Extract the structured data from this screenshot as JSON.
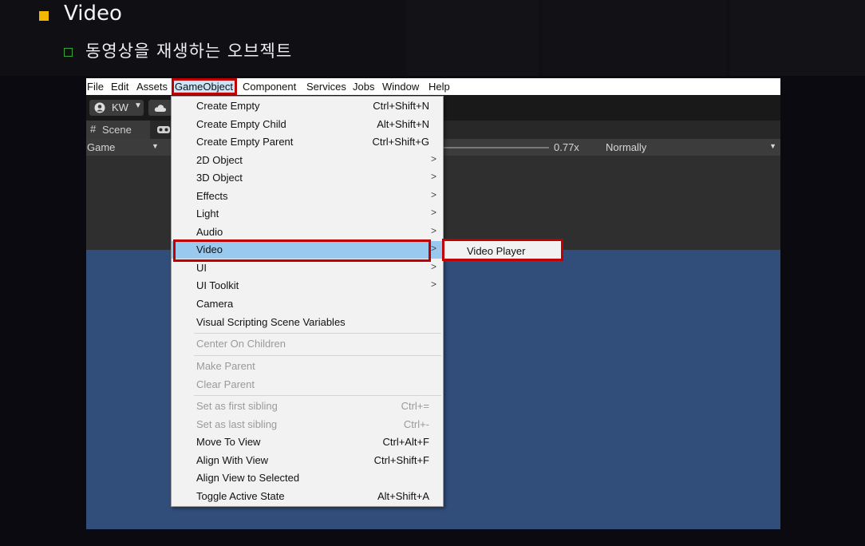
{
  "slide": {
    "title": "Video",
    "subtitle": "동영상을 재생하는 오브젝트",
    "colors": {
      "bullet_main": "#f2b800",
      "bullet_sub": "#3aa63a",
      "highlight_border": "#c00000"
    }
  },
  "unity": {
    "menubar": {
      "items": [
        "File",
        "Edit",
        "Assets",
        "GameObject",
        "Component",
        "Services",
        "Jobs",
        "Window",
        "Help"
      ],
      "active": "GameObject"
    },
    "toolbar": {
      "account_label": "KW",
      "account_icon": "user-icon",
      "cloud_icon": "cloud-icon"
    },
    "scene_tab": {
      "label": "Scene",
      "icon": "hash-icon"
    },
    "game_bar": {
      "display_label": "Game",
      "scale_value": "0.77x",
      "play_mode": "Normally"
    },
    "gameobject_menu": {
      "items": [
        {
          "label": "Create Empty",
          "shortcut": "Ctrl+Shift+N"
        },
        {
          "label": "Create Empty Child",
          "shortcut": "Alt+Shift+N"
        },
        {
          "label": "Create Empty Parent",
          "shortcut": "Ctrl+Shift+G"
        },
        {
          "label": "2D Object",
          "submenu": true
        },
        {
          "label": "3D Object",
          "submenu": true
        },
        {
          "label": "Effects",
          "submenu": true
        },
        {
          "label": "Light",
          "submenu": true
        },
        {
          "label": "Audio",
          "submenu": true
        },
        {
          "label": "Video",
          "submenu": true,
          "highlighted": true
        },
        {
          "label": "UI",
          "submenu": true
        },
        {
          "label": "UI Toolkit",
          "submenu": true
        },
        {
          "label": "Camera"
        },
        {
          "label": "Visual Scripting Scene Variables"
        },
        {
          "label": "Center On Children",
          "disabled": true
        },
        {
          "label": "Make Parent",
          "disabled": true
        },
        {
          "label": "Clear Parent",
          "disabled": true
        },
        {
          "label": "Set as first sibling",
          "shortcut": "Ctrl+=",
          "disabled": true
        },
        {
          "label": "Set as last sibling",
          "shortcut": "Ctrl+-",
          "disabled": true
        },
        {
          "label": "Move To View",
          "shortcut": "Ctrl+Alt+F"
        },
        {
          "label": "Align With View",
          "shortcut": "Ctrl+Shift+F"
        },
        {
          "label": "Align View to Selected"
        },
        {
          "label": "Toggle Active State",
          "shortcut": "Alt+Shift+A"
        }
      ]
    },
    "video_submenu": {
      "items": [
        "Video Player"
      ]
    }
  }
}
